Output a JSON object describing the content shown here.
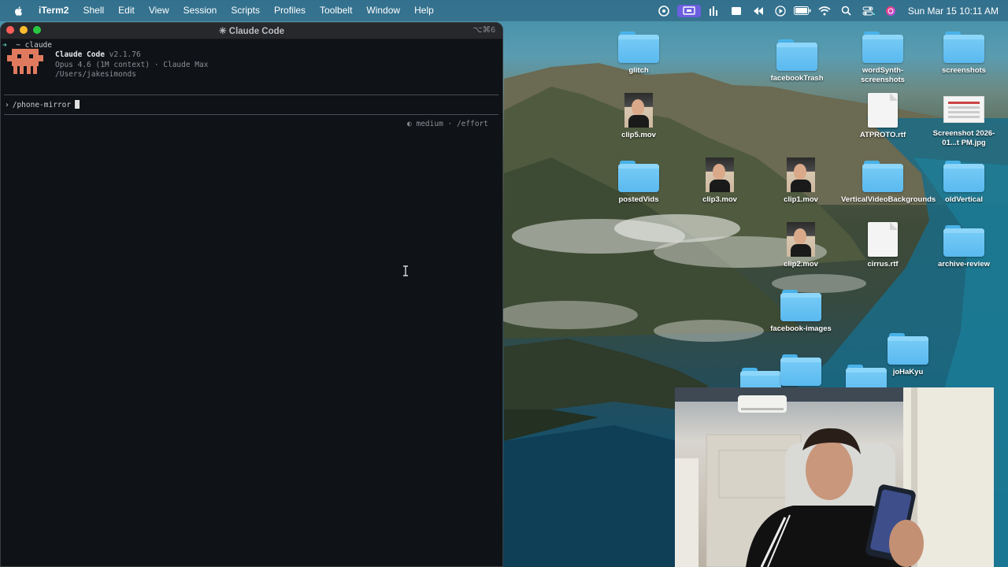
{
  "menubar": {
    "app_name": "iTerm2",
    "items": [
      "Shell",
      "Edit",
      "View",
      "Session",
      "Scripts",
      "Profiles",
      "Toolbelt",
      "Window",
      "Help"
    ],
    "clock": "Sun Mar 15  10:11 AM"
  },
  "terminal": {
    "title": "✳ Claude Code",
    "shortcut": "⌥⌘6",
    "prompt_dir": "~",
    "prompt_cmd": "claude",
    "app_name": "Claude Code",
    "version": "v2.1.76",
    "model_line": "Opus 4.6 (1M context) · Claude Max",
    "path": "/Users/jakesimonds",
    "input_text": "/phone-mirror",
    "effort": "◐ medium · /effort"
  },
  "desktop": {
    "icons": [
      {
        "label": "glitch",
        "type": "folder"
      },
      {
        "label": "facebookTrash",
        "type": "folder"
      },
      {
        "label": "wordSynth-screenshots",
        "type": "folder"
      },
      {
        "label": "screenshots",
        "type": "folder"
      },
      {
        "label": "clip5.mov",
        "type": "video"
      },
      {
        "label": "ATPROTO.rtf",
        "type": "document"
      },
      {
        "label": "Screenshot 2026-01...t PM.jpg",
        "type": "image"
      },
      {
        "label": "postedVids",
        "type": "folder"
      },
      {
        "label": "clip3.mov",
        "type": "video"
      },
      {
        "label": "clip1.mov",
        "type": "video"
      },
      {
        "label": "VerticalVideoBackgrounds",
        "type": "folder"
      },
      {
        "label": "oldVertical",
        "type": "folder"
      },
      {
        "label": "clip2.mov",
        "type": "video"
      },
      {
        "label": "cirrus.rtf",
        "type": "document"
      },
      {
        "label": "archive-review",
        "type": "folder"
      },
      {
        "label": "facebook-images",
        "type": "folder"
      },
      {
        "label": "joHaKyu",
        "type": "folder"
      }
    ]
  },
  "colors": {
    "terminal_bg": "#0f1216",
    "mascot": "#e07a5f",
    "folder": "#5ab9ef"
  }
}
